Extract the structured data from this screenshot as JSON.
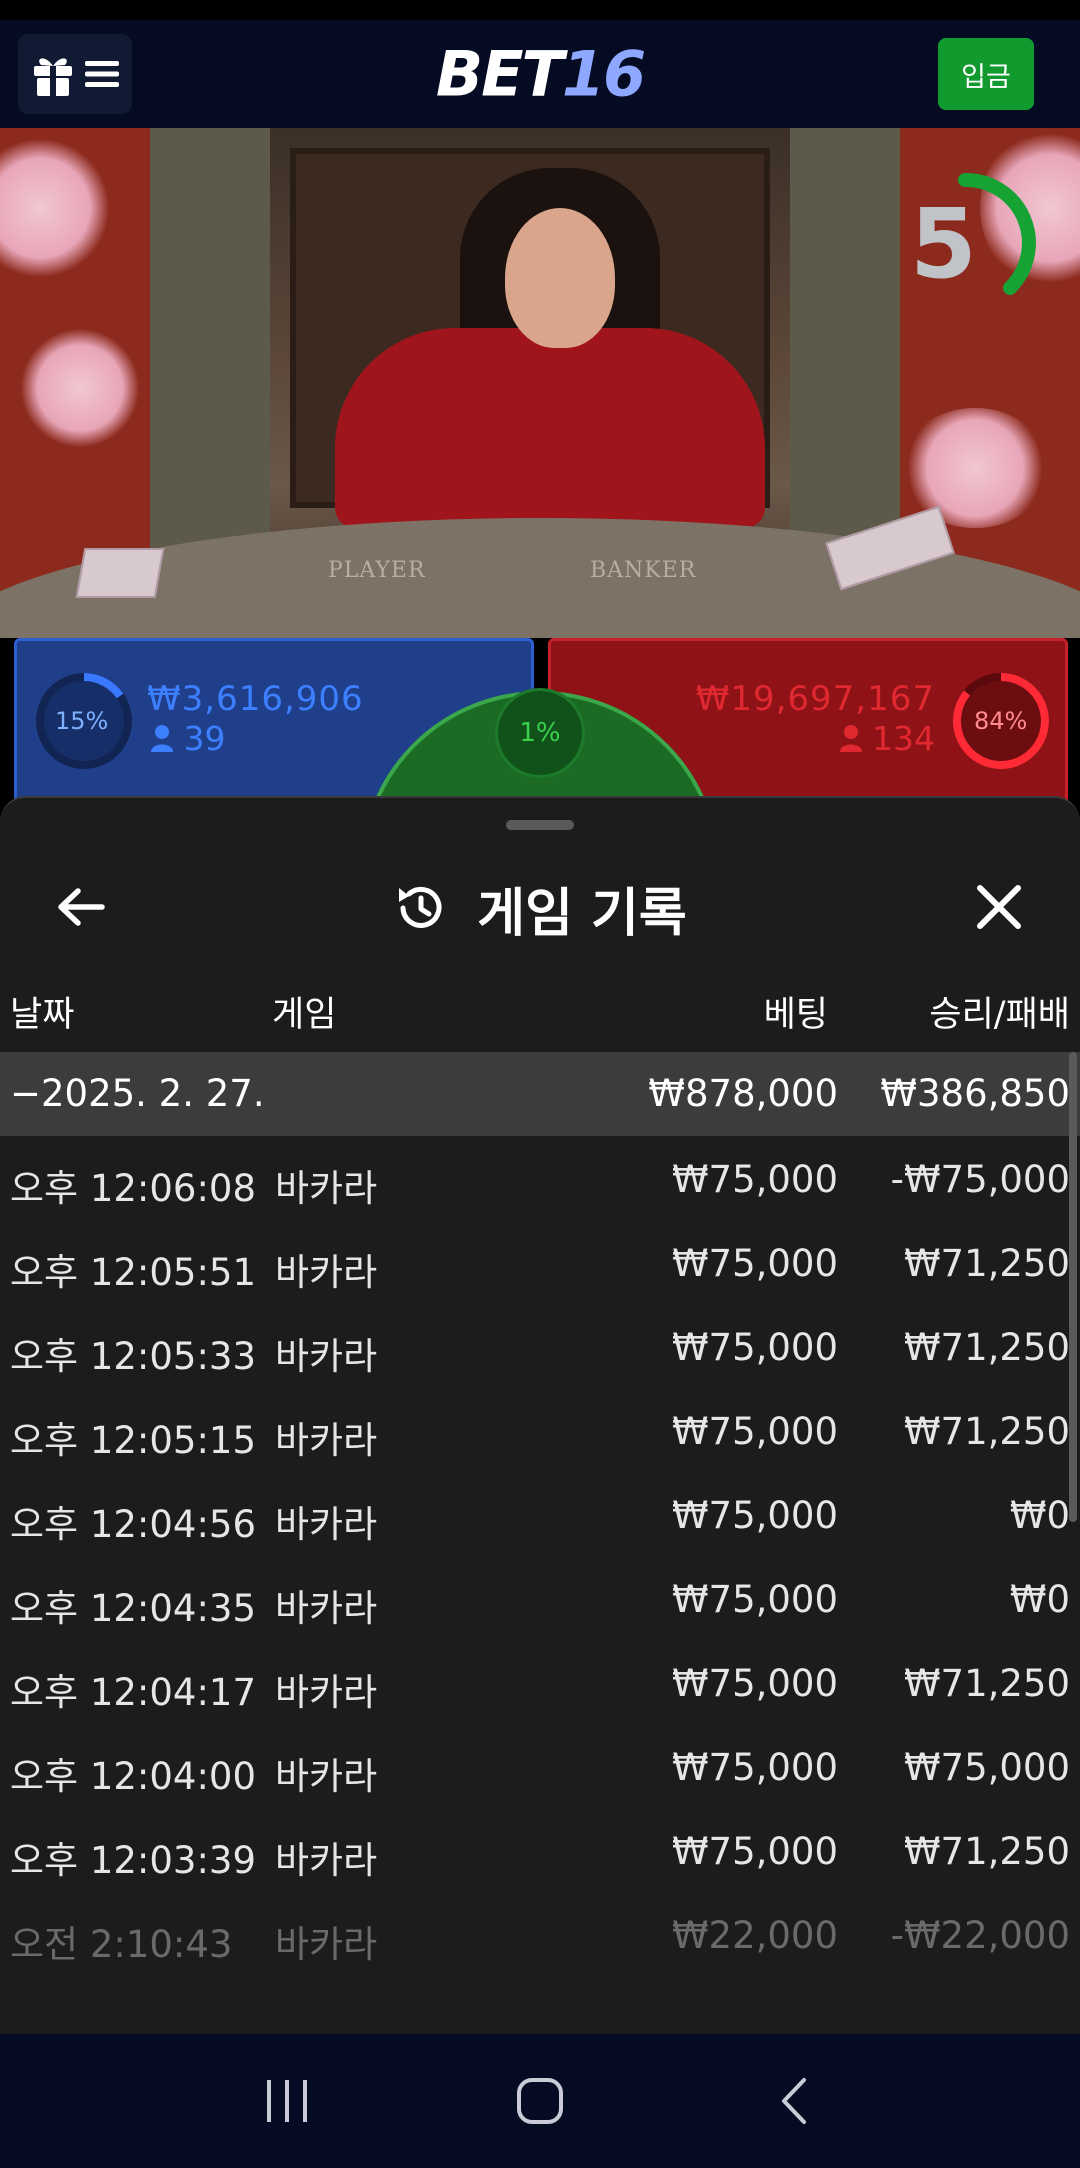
{
  "header": {
    "logo_part1": "BET",
    "logo_part2": "16",
    "deposit_label": "입금",
    "menu_icons": [
      "gift-icon",
      "hamburger-icon"
    ]
  },
  "game": {
    "countdown": "5",
    "table_labels": [
      "PLAYER",
      "BANKER"
    ],
    "player": {
      "percent": "15%",
      "amount": "₩3,616,906",
      "count": "39"
    },
    "banker": {
      "percent": "84%",
      "amount": "₩19,697,167",
      "count": "134"
    },
    "tie": {
      "percent": "1%"
    }
  },
  "history": {
    "title": "게임 기록",
    "columns": {
      "date": "날짜",
      "game": "게임",
      "bet": "베팅",
      "result": "승리/패배"
    },
    "date_group": {
      "label": "−2025. 2. 27.",
      "bet_total": "₩878,000",
      "result_total": "₩386,850"
    },
    "rows": [
      {
        "time": "오후 12:06:08",
        "game": "바카라",
        "bet": "₩75,000",
        "result": "-₩75,000"
      },
      {
        "time": "오후 12:05:51",
        "game": "바카라",
        "bet": "₩75,000",
        "result": "₩71,250"
      },
      {
        "time": "오후 12:05:33",
        "game": "바카라",
        "bet": "₩75,000",
        "result": "₩71,250"
      },
      {
        "time": "오후 12:05:15",
        "game": "바카라",
        "bet": "₩75,000",
        "result": "₩71,250"
      },
      {
        "time": "오후 12:04:56",
        "game": "바카라",
        "bet": "₩75,000",
        "result": "₩0"
      },
      {
        "time": "오후 12:04:35",
        "game": "바카라",
        "bet": "₩75,000",
        "result": "₩0"
      },
      {
        "time": "오후 12:04:17",
        "game": "바카라",
        "bet": "₩75,000",
        "result": "₩71,250"
      },
      {
        "time": "오후 12:04:00",
        "game": "바카라",
        "bet": "₩75,000",
        "result": "₩75,000"
      },
      {
        "time": "오후 12:03:39",
        "game": "바카라",
        "bet": "₩75,000",
        "result": "₩71,250"
      },
      {
        "time": "오전 2:10:43",
        "game": "바카라",
        "bet": "₩22,000",
        "result": "-₩22,000"
      }
    ]
  },
  "colors": {
    "topbar": "#050b22",
    "deposit": "#119b2f",
    "player": "#2d5fcf",
    "banker": "#c4212a",
    "tie": "#3aa84a",
    "sheet": "#1c1c1c"
  },
  "navbar": {
    "items": [
      "recent-apps-icon",
      "home-icon",
      "back-icon"
    ]
  }
}
